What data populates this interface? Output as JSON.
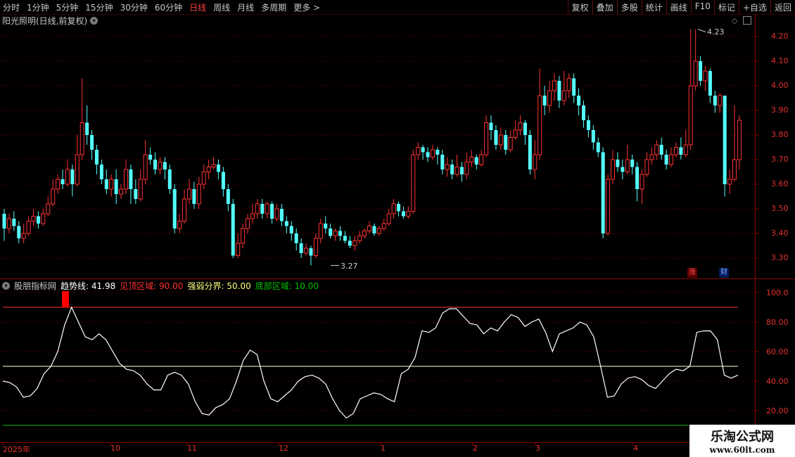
{
  "toolbar": {
    "periods": [
      "分时",
      "1分钟",
      "5分钟",
      "15分钟",
      "30分钟",
      "60分钟",
      "日线",
      "周线",
      "月线",
      "多周期",
      "更多 >"
    ],
    "active_period": "日线",
    "buttons": [
      "复权",
      "叠加",
      "多股",
      "统计",
      "画线",
      "F10",
      "标记",
      "+自选",
      "返回"
    ]
  },
  "chart_title": "阳光照明(日线,前复权)",
  "price_axis": [
    "4.20",
    "4.10",
    "4.00",
    "3.90",
    "3.80",
    "3.70",
    "3.60",
    "3.50",
    "3.40",
    "3.30"
  ],
  "annotations": {
    "high": "4.23",
    "low": "3.27"
  },
  "badges": {
    "zhang": "涨",
    "cai": "财"
  },
  "indicator": {
    "name": "股朋指标网",
    "trend_label": "趋势线:",
    "trend_value": "41.98",
    "top_label": "见顶区域:",
    "top_value": "90.00",
    "mid_label": "强弱分界:",
    "mid_value": "50.00",
    "bottom_label": "底部区域:",
    "bottom_value": "10.00",
    "axis": [
      "100.0",
      "80.00",
      "60.00",
      "40.00",
      "20.00"
    ]
  },
  "date_axis": [
    "2025年",
    "10",
    "11",
    "12",
    "1",
    "2",
    "3",
    "4"
  ],
  "watermark": {
    "title": "乐淘公式网",
    "url": "www.60lt.com"
  },
  "colors": {
    "up": "#ff3232",
    "down": "#54ffff",
    "grid": "#8b0000",
    "trend": "#ffffff",
    "mid": "#ffff80",
    "bottom": "#00c000"
  },
  "chart_data": {
    "type": "candlestick",
    "ylim": [
      3.25,
      4.25
    ],
    "candles": [
      [
        3.48,
        3.42,
        3.5,
        3.37
      ],
      [
        3.42,
        3.46,
        3.48,
        3.4
      ],
      [
        3.46,
        3.43,
        3.49,
        3.41
      ],
      [
        3.43,
        3.38,
        3.45,
        3.36
      ],
      [
        3.38,
        3.4,
        3.44,
        3.36
      ],
      [
        3.4,
        3.45,
        3.47,
        3.39
      ],
      [
        3.45,
        3.47,
        3.5,
        3.43
      ],
      [
        3.47,
        3.44,
        3.49,
        3.42
      ],
      [
        3.44,
        3.48,
        3.5,
        3.43
      ],
      [
        3.48,
        3.52,
        3.55,
        3.47
      ],
      [
        3.52,
        3.58,
        3.62,
        3.51
      ],
      [
        3.58,
        3.62,
        3.64,
        3.56
      ],
      [
        3.62,
        3.6,
        3.66,
        3.58
      ],
      [
        3.6,
        3.66,
        3.7,
        3.59
      ],
      [
        3.66,
        3.6,
        3.68,
        3.55
      ],
      [
        3.6,
        3.72,
        3.8,
        3.59
      ],
      [
        3.72,
        3.85,
        4.03,
        3.7
      ],
      [
        3.85,
        3.8,
        3.92,
        3.76
      ],
      [
        3.8,
        3.74,
        3.82,
        3.7
      ],
      [
        3.74,
        3.68,
        3.76,
        3.64
      ],
      [
        3.68,
        3.62,
        3.7,
        3.6
      ],
      [
        3.62,
        3.58,
        3.66,
        3.56
      ],
      [
        3.58,
        3.62,
        3.64,
        3.55
      ],
      [
        3.62,
        3.56,
        3.66,
        3.52
      ],
      [
        3.56,
        3.58,
        3.6,
        3.54
      ],
      [
        3.58,
        3.66,
        3.7,
        3.56
      ],
      [
        3.66,
        3.58,
        3.68,
        3.52
      ],
      [
        3.58,
        3.54,
        3.62,
        3.52
      ],
      [
        3.54,
        3.62,
        3.66,
        3.53
      ],
      [
        3.62,
        3.72,
        3.78,
        3.6
      ],
      [
        3.72,
        3.7,
        3.75,
        3.68
      ],
      [
        3.7,
        3.66,
        3.73,
        3.64
      ],
      [
        3.66,
        3.69,
        3.71,
        3.64
      ],
      [
        3.69,
        3.66,
        3.71,
        3.62
      ],
      [
        3.66,
        3.58,
        3.68,
        3.56
      ],
      [
        3.58,
        3.42,
        3.6,
        3.4
      ],
      [
        3.42,
        3.45,
        3.48,
        3.4
      ],
      [
        3.45,
        3.54,
        3.58,
        3.44
      ],
      [
        3.54,
        3.58,
        3.62,
        3.52
      ],
      [
        3.58,
        3.52,
        3.61,
        3.5
      ],
      [
        3.52,
        3.6,
        3.63,
        3.5
      ],
      [
        3.6,
        3.65,
        3.68,
        3.58
      ],
      [
        3.65,
        3.67,
        3.7,
        3.62
      ],
      [
        3.67,
        3.68,
        3.71,
        3.66
      ],
      [
        3.68,
        3.65,
        3.7,
        3.62
      ],
      [
        3.65,
        3.58,
        3.67,
        3.55
      ],
      [
        3.58,
        3.52,
        3.6,
        3.49
      ],
      [
        3.52,
        3.31,
        3.54,
        3.3
      ],
      [
        3.31,
        3.36,
        3.4,
        3.3
      ],
      [
        3.36,
        3.42,
        3.44,
        3.34
      ],
      [
        3.42,
        3.46,
        3.48,
        3.4
      ],
      [
        3.46,
        3.48,
        3.52,
        3.44
      ],
      [
        3.48,
        3.52,
        3.54,
        3.46
      ],
      [
        3.52,
        3.48,
        3.54,
        3.46
      ],
      [
        3.48,
        3.52,
        3.53,
        3.46
      ],
      [
        3.52,
        3.46,
        3.53,
        3.44
      ],
      [
        3.46,
        3.5,
        3.52,
        3.45
      ],
      [
        3.5,
        3.45,
        3.52,
        3.43
      ],
      [
        3.45,
        3.43,
        3.47,
        3.4
      ],
      [
        3.43,
        3.4,
        3.45,
        3.37
      ],
      [
        3.4,
        3.36,
        3.42,
        3.33
      ],
      [
        3.36,
        3.32,
        3.38,
        3.3
      ],
      [
        3.32,
        3.34,
        3.36,
        3.31
      ],
      [
        3.34,
        3.31,
        3.35,
        3.27
      ],
      [
        3.31,
        3.38,
        3.4,
        3.3
      ],
      [
        3.38,
        3.44,
        3.46,
        3.36
      ],
      [
        3.44,
        3.42,
        3.47,
        3.4
      ],
      [
        3.42,
        3.39,
        3.44,
        3.38
      ],
      [
        3.39,
        3.41,
        3.42,
        3.37
      ],
      [
        3.41,
        3.39,
        3.43,
        3.37
      ],
      [
        3.39,
        3.37,
        3.41,
        3.36
      ],
      [
        3.37,
        3.35,
        3.39,
        3.34
      ],
      [
        3.35,
        3.37,
        3.39,
        3.33
      ],
      [
        3.37,
        3.39,
        3.41,
        3.36
      ],
      [
        3.39,
        3.41,
        3.42,
        3.38
      ],
      [
        3.41,
        3.43,
        3.45,
        3.4
      ],
      [
        3.43,
        3.4,
        3.44,
        3.39
      ],
      [
        3.4,
        3.42,
        3.43,
        3.39
      ],
      [
        3.42,
        3.44,
        3.46,
        3.41
      ],
      [
        3.44,
        3.48,
        3.5,
        3.43
      ],
      [
        3.48,
        3.52,
        3.54,
        3.46
      ],
      [
        3.52,
        3.49,
        3.53,
        3.47
      ],
      [
        3.49,
        3.47,
        3.51,
        3.46
      ],
      [
        3.47,
        3.49,
        3.51,
        3.46
      ],
      [
        3.49,
        3.72,
        3.74,
        3.48
      ],
      [
        3.72,
        3.75,
        3.77,
        3.7
      ],
      [
        3.75,
        3.73,
        3.76,
        3.7
      ],
      [
        3.73,
        3.71,
        3.75,
        3.69
      ],
      [
        3.71,
        3.74,
        3.76,
        3.7
      ],
      [
        3.74,
        3.72,
        3.75,
        3.68
      ],
      [
        3.72,
        3.66,
        3.74,
        3.64
      ],
      [
        3.66,
        3.68,
        3.71,
        3.63
      ],
      [
        3.68,
        3.64,
        3.7,
        3.62
      ],
      [
        3.64,
        3.67,
        3.72,
        3.63
      ],
      [
        3.67,
        3.64,
        3.69,
        3.61
      ],
      [
        3.64,
        3.69,
        3.73,
        3.62
      ],
      [
        3.69,
        3.71,
        3.74,
        3.67
      ],
      [
        3.71,
        3.68,
        3.72,
        3.66
      ],
      [
        3.68,
        3.72,
        3.74,
        3.67
      ],
      [
        3.72,
        3.85,
        3.88,
        3.71
      ],
      [
        3.85,
        3.82,
        3.88,
        3.78
      ],
      [
        3.82,
        3.76,
        3.84,
        3.74
      ],
      [
        3.76,
        3.8,
        3.83,
        3.74
      ],
      [
        3.8,
        3.74,
        3.82,
        3.72
      ],
      [
        3.74,
        3.79,
        3.82,
        3.73
      ],
      [
        3.79,
        3.82,
        3.86,
        3.78
      ],
      [
        3.82,
        3.85,
        3.88,
        3.8
      ],
      [
        3.85,
        3.8,
        3.86,
        3.76
      ],
      [
        3.8,
        3.66,
        3.82,
        3.64
      ],
      [
        3.66,
        3.72,
        3.78,
        3.62
      ],
      [
        3.72,
        3.96,
        4.07,
        3.7
      ],
      [
        3.96,
        3.92,
        4.0,
        3.88
      ],
      [
        3.92,
        3.98,
        4.02,
        3.89
      ],
      [
        3.98,
        4.02,
        4.05,
        3.94
      ],
      [
        4.02,
        3.94,
        4.04,
        3.91
      ],
      [
        3.94,
        3.98,
        4.06,
        3.92
      ],
      [
        3.98,
        4.03,
        4.05,
        3.95
      ],
      [
        4.03,
        3.96,
        4.05,
        3.93
      ],
      [
        3.96,
        3.92,
        3.99,
        3.88
      ],
      [
        3.92,
        3.86,
        3.94,
        3.83
      ],
      [
        3.86,
        3.82,
        3.88,
        3.79
      ],
      [
        3.82,
        3.77,
        3.84,
        3.74
      ],
      [
        3.77,
        3.73,
        3.79,
        3.71
      ],
      [
        3.73,
        3.4,
        3.75,
        3.38
      ],
      [
        3.4,
        3.62,
        3.64,
        3.39
      ],
      [
        3.62,
        3.7,
        3.74,
        3.6
      ],
      [
        3.7,
        3.67,
        3.73,
        3.65
      ],
      [
        3.67,
        3.65,
        3.7,
        3.62
      ],
      [
        3.65,
        3.7,
        3.76,
        3.64
      ],
      [
        3.7,
        3.67,
        3.72,
        3.64
      ],
      [
        3.67,
        3.58,
        3.69,
        3.53
      ],
      [
        3.58,
        3.64,
        3.66,
        3.52
      ],
      [
        3.64,
        3.7,
        3.73,
        3.63
      ],
      [
        3.7,
        3.72,
        3.75,
        3.68
      ],
      [
        3.72,
        3.76,
        3.78,
        3.7
      ],
      [
        3.76,
        3.72,
        3.79,
        3.7
      ],
      [
        3.72,
        3.68,
        3.74,
        3.66
      ],
      [
        3.68,
        3.72,
        3.75,
        3.67
      ],
      [
        3.72,
        3.75,
        3.77,
        3.71
      ],
      [
        3.75,
        3.72,
        3.79,
        3.7
      ],
      [
        3.72,
        3.76,
        3.82,
        3.71
      ],
      [
        3.76,
        4.0,
        4.23,
        3.74
      ],
      [
        4.0,
        4.1,
        4.23,
        3.98
      ],
      [
        4.1,
        4.02,
        4.12,
        4.0
      ],
      [
        4.02,
        4.06,
        4.08,
        3.98
      ],
      [
        4.06,
        3.96,
        4.07,
        3.93
      ],
      [
        3.96,
        3.92,
        3.98,
        3.89
      ],
      [
        3.92,
        3.96,
        3.97,
        3.89
      ],
      [
        3.96,
        3.6,
        3.85,
        3.55
      ],
      [
        3.6,
        3.62,
        3.66,
        3.56
      ],
      [
        3.62,
        3.7,
        3.92,
        3.61
      ],
      [
        3.7,
        3.86,
        3.88,
        3.66
      ]
    ],
    "trend": [
      40,
      39,
      36,
      29,
      30,
      35,
      45,
      50,
      60,
      78,
      90,
      80,
      70,
      68,
      72,
      68,
      60,
      52,
      48,
      47,
      44,
      38,
      34,
      34,
      44,
      46,
      44,
      38,
      26,
      18,
      17,
      22,
      24,
      28,
      40,
      54,
      61,
      58,
      40,
      28,
      26,
      30,
      34,
      40,
      43,
      44,
      42,
      38,
      28,
      20,
      15,
      18,
      28,
      30,
      32,
      31,
      28,
      26,
      45,
      48,
      56,
      74,
      73,
      76,
      86,
      89,
      89,
      84,
      79,
      78,
      72,
      76,
      74,
      80,
      85,
      83,
      77,
      80,
      82,
      73,
      60,
      72,
      74,
      76,
      80,
      78,
      70,
      50,
      29,
      30,
      38,
      42,
      43,
      41,
      37,
      35,
      40,
      45,
      48,
      47,
      50,
      73,
      74,
      74,
      68,
      44,
      42,
      44
    ]
  }
}
